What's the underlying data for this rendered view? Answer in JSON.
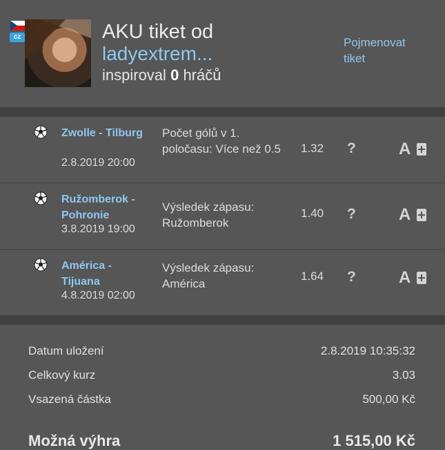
{
  "header": {
    "title_prefix": "AKU tiket od",
    "username": "ladyextrem...",
    "inspired_prefix": "inspiroval",
    "inspired_count": "0",
    "inspired_suffix": "hráčů",
    "lang_badge": "cz",
    "rename_link": "Pojmenovat tiket"
  },
  "bets": [
    {
      "match": "Zwolle - Tilburg",
      "date": "2.8.2019 20:00",
      "tip": "Počet gólů v 1. poločasu: Více než 0.5",
      "odds": "1.32",
      "help": "?",
      "icon_letter": "A"
    },
    {
      "match": "Ružomberok - Pohronie",
      "date": "3.8.2019 19:00",
      "tip": "Výsledek zápasu: Ružomberok",
      "odds": "1.40",
      "help": "?",
      "icon_letter": "A"
    },
    {
      "match": "América - Tijuana",
      "date": "4.8.2019 02:00",
      "tip": "Výsledek zápasu: América",
      "odds": "1.64",
      "help": "?",
      "icon_letter": "A"
    }
  ],
  "summary": {
    "saved_label": "Datum uložení",
    "saved_value": "2.8.2019 10:35:32",
    "total_odds_label": "Celkový kurz",
    "total_odds_value": "3.03",
    "stake_label": "Vsazená částka",
    "stake_value": "500,00 Kč",
    "win_label": "Možná výhra",
    "win_value": "1 515,00 Kč"
  },
  "icons": {
    "sport": "soccer-ball-icon",
    "help": "question-mark-icon",
    "analysis": "a-letter-icon",
    "add": "add-to-ticket-icon"
  }
}
